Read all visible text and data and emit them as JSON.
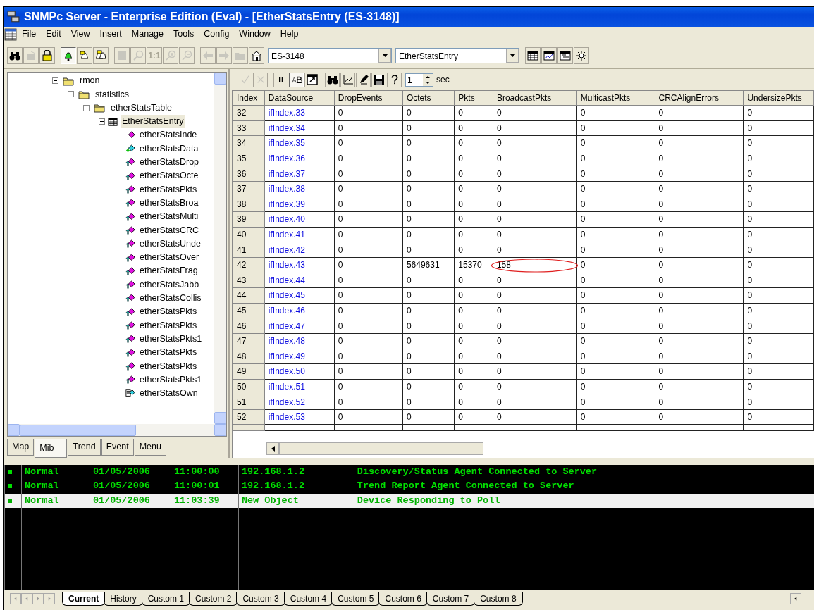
{
  "window": {
    "title": "SNMPc Server - Enterprise Edition (Eval) - [EtherStatsEntry (ES-3148)]"
  },
  "menu": [
    "File",
    "Edit",
    "View",
    "Insert",
    "Manage",
    "Tools",
    "Config",
    "Window",
    "Help"
  ],
  "toolbar": [
    {
      "kind": "binoculars",
      "disabled": false,
      "pressed": false
    },
    {
      "kind": "properties",
      "disabled": true,
      "pressed": false
    },
    {
      "kind": "lock",
      "disabled": false,
      "pressed": false
    },
    {
      "kind": "sep"
    },
    {
      "kind": "bell",
      "disabled": false,
      "pressed": true
    },
    {
      "kind": "bell-note",
      "disabled": false,
      "pressed": false
    },
    {
      "kind": "bells",
      "disabled": false,
      "pressed": false
    },
    {
      "kind": "sep"
    },
    {
      "kind": "square",
      "disabled": true,
      "pressed": false
    },
    {
      "kind": "zoom",
      "disabled": true,
      "pressed": false
    },
    {
      "kind": "text",
      "label": "1:1",
      "disabled": true,
      "pressed": false
    },
    {
      "kind": "zoom-in",
      "disabled": true,
      "pressed": false
    },
    {
      "kind": "zoom-out",
      "disabled": true,
      "pressed": false
    },
    {
      "kind": "sep"
    },
    {
      "kind": "back",
      "disabled": true,
      "pressed": false
    },
    {
      "kind": "forward",
      "disabled": true,
      "pressed": false
    },
    {
      "kind": "folder",
      "disabled": true,
      "pressed": false
    },
    {
      "kind": "home",
      "disabled": false,
      "pressed": false
    }
  ],
  "device_combo": {
    "value": "ES-3148"
  },
  "object_combo": {
    "value": "EtherStatsEntry"
  },
  "view_buttons": [
    {
      "kind": "table"
    },
    {
      "kind": "chart-window"
    },
    {
      "kind": "list-window"
    },
    {
      "kind": "sun"
    }
  ],
  "tree": [
    {
      "label": "rmon",
      "kind": "folder",
      "selected": false,
      "children": [
        {
          "label": "statistics",
          "kind": "folder",
          "selected": false,
          "children": [
            {
              "label": "etherStatsTable",
              "kind": "folder",
              "selected": false,
              "children": [
                {
                  "label": "EtherStatsEntry",
                  "kind": "table",
                  "selected": true,
                  "children": [
                    {
                      "label": "etherStatsInde",
                      "kind": "index",
                      "selected": false
                    },
                    {
                      "label": "etherStatsData",
                      "kind": "data",
                      "selected": false
                    },
                    {
                      "label": "etherStatsDrop",
                      "kind": "counter",
                      "selected": false
                    },
                    {
                      "label": "etherStatsOcte",
                      "kind": "counter",
                      "selected": false
                    },
                    {
                      "label": "etherStatsPkts",
                      "kind": "counter",
                      "selected": false
                    },
                    {
                      "label": "etherStatsBroa",
                      "kind": "counter",
                      "selected": false
                    },
                    {
                      "label": "etherStatsMulti",
                      "kind": "counter",
                      "selected": false
                    },
                    {
                      "label": "etherStatsCRC",
                      "kind": "counter",
                      "selected": false
                    },
                    {
                      "label": "etherStatsUnde",
                      "kind": "counter",
                      "selected": false
                    },
                    {
                      "label": "etherStatsOver",
                      "kind": "counter",
                      "selected": false
                    },
                    {
                      "label": "etherStatsFrag",
                      "kind": "counter",
                      "selected": false
                    },
                    {
                      "label": "etherStatsJabb",
                      "kind": "counter",
                      "selected": false
                    },
                    {
                      "label": "etherStatsCollis",
                      "kind": "counter",
                      "selected": false
                    },
                    {
                      "label": "etherStatsPkts",
                      "kind": "counter",
                      "selected": false
                    },
                    {
                      "label": "etherStatsPkts",
                      "kind": "counter",
                      "selected": false
                    },
                    {
                      "label": "etherStatsPkts1",
                      "kind": "counter",
                      "selected": false
                    },
                    {
                      "label": "etherStatsPkts",
                      "kind": "counter",
                      "selected": false
                    },
                    {
                      "label": "etherStatsPkts",
                      "kind": "counter",
                      "selected": false
                    },
                    {
                      "label": "etherStatsPkts1",
                      "kind": "counter",
                      "selected": false
                    },
                    {
                      "label": "etherStatsOwn",
                      "kind": "owner",
                      "selected": false
                    }
                  ]
                }
              ]
            }
          ]
        }
      ]
    }
  ],
  "left_tabs": [
    {
      "label": "Map",
      "selected": false
    },
    {
      "label": "Mib",
      "selected": true
    },
    {
      "label": "Trend",
      "selected": false
    },
    {
      "label": "Event",
      "selected": false
    },
    {
      "label": "Menu",
      "selected": false
    }
  ],
  "table_toolbar": [
    {
      "kind": "check",
      "disabled": true,
      "pressed": false
    },
    {
      "kind": "cross",
      "disabled": true,
      "pressed": false
    },
    {
      "kind": "sep"
    },
    {
      "kind": "pause",
      "disabled": false,
      "pressed": false
    },
    {
      "kind": "ab",
      "disabled": false,
      "pressed": true
    },
    {
      "kind": "window",
      "disabled": false,
      "pressed": false
    },
    {
      "kind": "sep"
    },
    {
      "kind": "binoculars",
      "disabled": false,
      "pressed": false
    },
    {
      "kind": "chart",
      "disabled": false,
      "pressed": false
    },
    {
      "kind": "pencil",
      "disabled": false,
      "pressed": false
    },
    {
      "kind": "save",
      "disabled": false,
      "pressed": false
    },
    {
      "kind": "help",
      "disabled": false,
      "pressed": false
    }
  ],
  "interval": {
    "value": "1",
    "unit": "sec"
  },
  "table": {
    "columns": [
      "Index",
      "DataSource",
      "DropEvents",
      "Octets",
      "Pkts",
      "BroadcastPkts",
      "MulticastPkts",
      "CRCAlignErrors",
      "UndersizePkts"
    ],
    "rows": [
      {
        "index": "32",
        "source": "ifIndex.33",
        "values": [
          "0",
          "0",
          "0",
          "0",
          "0",
          "0",
          "0"
        ],
        "circled": false
      },
      {
        "index": "33",
        "source": "ifIndex.34",
        "values": [
          "0",
          "0",
          "0",
          "0",
          "0",
          "0",
          "0"
        ],
        "circled": false
      },
      {
        "index": "34",
        "source": "ifIndex.35",
        "values": [
          "0",
          "0",
          "0",
          "0",
          "0",
          "0",
          "0"
        ],
        "circled": false
      },
      {
        "index": "35",
        "source": "ifIndex.36",
        "values": [
          "0",
          "0",
          "0",
          "0",
          "0",
          "0",
          "0"
        ],
        "circled": false
      },
      {
        "index": "36",
        "source": "ifIndex.37",
        "values": [
          "0",
          "0",
          "0",
          "0",
          "0",
          "0",
          "0"
        ],
        "circled": false
      },
      {
        "index": "37",
        "source": "ifIndex.38",
        "values": [
          "0",
          "0",
          "0",
          "0",
          "0",
          "0",
          "0"
        ],
        "circled": false
      },
      {
        "index": "38",
        "source": "ifIndex.39",
        "values": [
          "0",
          "0",
          "0",
          "0",
          "0",
          "0",
          "0"
        ],
        "circled": false
      },
      {
        "index": "39",
        "source": "ifIndex.40",
        "values": [
          "0",
          "0",
          "0",
          "0",
          "0",
          "0",
          "0"
        ],
        "circled": false
      },
      {
        "index": "40",
        "source": "ifIndex.41",
        "values": [
          "0",
          "0",
          "0",
          "0",
          "0",
          "0",
          "0"
        ],
        "circled": false
      },
      {
        "index": "41",
        "source": "ifIndex.42",
        "values": [
          "0",
          "0",
          "0",
          "0",
          "0",
          "0",
          "0"
        ],
        "circled": false
      },
      {
        "index": "42",
        "source": "ifIndex.43",
        "values": [
          "0",
          "5649631",
          "15370",
          "158",
          "0",
          "0",
          "0"
        ],
        "circled": true
      },
      {
        "index": "43",
        "source": "ifIndex.44",
        "values": [
          "0",
          "0",
          "0",
          "0",
          "0",
          "0",
          "0"
        ],
        "circled": false
      },
      {
        "index": "44",
        "source": "ifIndex.45",
        "values": [
          "0",
          "0",
          "0",
          "0",
          "0",
          "0",
          "0"
        ],
        "circled": false
      },
      {
        "index": "45",
        "source": "ifIndex.46",
        "values": [
          "0",
          "0",
          "0",
          "0",
          "0",
          "0",
          "0"
        ],
        "circled": false
      },
      {
        "index": "46",
        "source": "ifIndex.47",
        "values": [
          "0",
          "0",
          "0",
          "0",
          "0",
          "0",
          "0"
        ],
        "circled": false
      },
      {
        "index": "47",
        "source": "ifIndex.48",
        "values": [
          "0",
          "0",
          "0",
          "0",
          "0",
          "0",
          "0"
        ],
        "circled": false
      },
      {
        "index": "48",
        "source": "ifIndex.49",
        "values": [
          "0",
          "0",
          "0",
          "0",
          "0",
          "0",
          "0"
        ],
        "circled": false
      },
      {
        "index": "49",
        "source": "ifIndex.50",
        "values": [
          "0",
          "0",
          "0",
          "0",
          "0",
          "0",
          "0"
        ],
        "circled": false
      },
      {
        "index": "50",
        "source": "ifIndex.51",
        "values": [
          "0",
          "0",
          "0",
          "0",
          "0",
          "0",
          "0"
        ],
        "circled": false
      },
      {
        "index": "51",
        "source": "ifIndex.52",
        "values": [
          "0",
          "0",
          "0",
          "0",
          "0",
          "0",
          "0"
        ],
        "circled": false
      },
      {
        "index": "52",
        "source": "ifIndex.53",
        "values": [
          "0",
          "0",
          "0",
          "0",
          "0",
          "0",
          "0"
        ],
        "circled": false
      }
    ]
  },
  "event_log": [
    {
      "severity": "Normal",
      "date": "01/05/2006",
      "time": "11:00:00",
      "source": "192.168.1.2",
      "message": "Discovery/Status Agent Connected to Server",
      "selected": false
    },
    {
      "severity": "Normal",
      "date": "01/05/2006",
      "time": "11:00:01",
      "source": "192.168.1.2",
      "message": "Trend Report Agent Connected to Server",
      "selected": false
    },
    {
      "severity": "Normal",
      "date": "01/05/2006",
      "time": "11:03:39",
      "source": "New_Object",
      "message": "Device Responding to Poll",
      "selected": true
    }
  ],
  "log_tabs": [
    {
      "label": "Current",
      "selected": true
    },
    {
      "label": "History",
      "selected": false
    },
    {
      "label": "Custom 1",
      "selected": false
    },
    {
      "label": "Custom 2",
      "selected": false
    },
    {
      "label": "Custom 3",
      "selected": false
    },
    {
      "label": "Custom 4",
      "selected": false
    },
    {
      "label": "Custom 5",
      "selected": false
    },
    {
      "label": "Custom 6",
      "selected": false
    },
    {
      "label": "Custom 7",
      "selected": false
    },
    {
      "label": "Custom 8",
      "selected": false
    }
  ]
}
